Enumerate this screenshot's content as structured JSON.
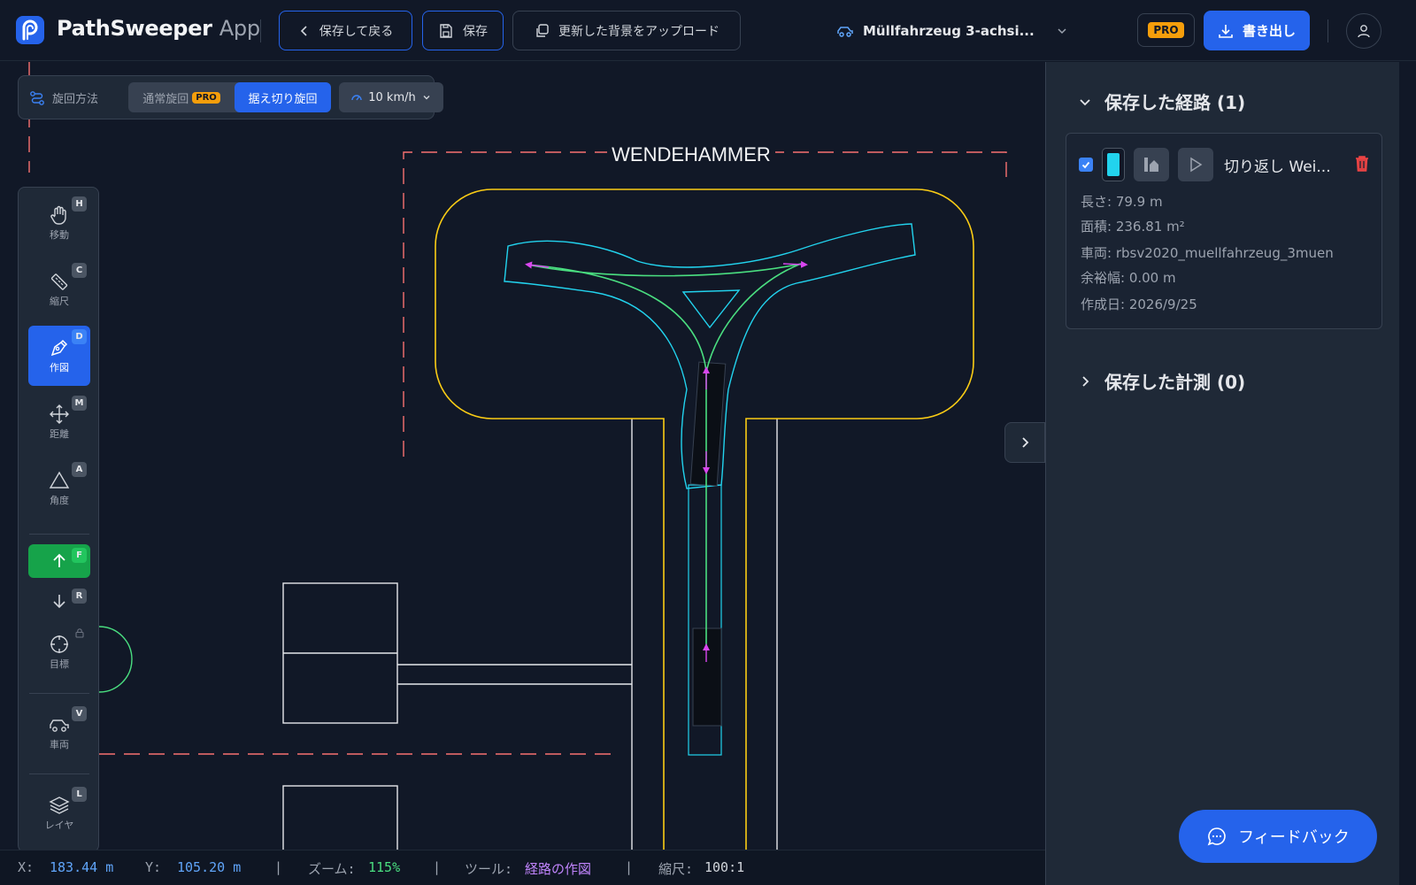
{
  "header": {
    "brand_name": "PathSweeper",
    "brand_suffix": "App",
    "back_label": "保存して戻る",
    "save_label": "保存",
    "upload_label": "更新した背景をアップロード",
    "vehicle_selected": "Müllfahrzeug 3-achsi...",
    "pro_label": "PRO",
    "export_label": "書き出し"
  },
  "turn_controls": {
    "label": "旋回方法",
    "normal_turn": "通常旋回",
    "normal_turn_badge": "PRO",
    "pivot_turn": "据え切り旋回",
    "speed": "10 km/h"
  },
  "canvas": {
    "area_label": "WENDEHAMMER",
    "colors": {
      "boundary": "#facc15",
      "envelope": "#22d3ee",
      "path": "#4ade80",
      "arrows": "#d946ef",
      "dashed": "#f87171",
      "lines": "#e5e7eb"
    }
  },
  "tools": [
    {
      "label": "移動",
      "key": "H",
      "icon": "hand-icon"
    },
    {
      "label": "縮尺",
      "key": "C",
      "icon": "ruler-icon"
    },
    {
      "label": "作図",
      "key": "D",
      "icon": "pen-icon"
    },
    {
      "label": "距離",
      "key": "M",
      "icon": "move-icon"
    },
    {
      "label": "角度",
      "key": "A",
      "icon": "triangle-icon"
    },
    {
      "label": "",
      "key": "F",
      "icon": "arrow-up-icon"
    },
    {
      "label": "",
      "key": "R",
      "icon": "arrow-down-icon"
    },
    {
      "label": "目標",
      "key": "",
      "icon": "crosshair-icon"
    },
    {
      "label": "車両",
      "key": "V",
      "icon": "car-icon"
    },
    {
      "label": "レイヤ",
      "key": "L",
      "icon": "layers-icon"
    }
  ],
  "panel": {
    "saved_routes_title": "保存した経路 (1)",
    "saved_measures_title": "保存した計測 (0)",
    "route": {
      "name": "切り返し Wei...",
      "color": "#22d3ee",
      "length": "長さ: 79.9 m",
      "area": "面積: 236.81 m²",
      "vehicle": "車両: rbsv2020_muellfahrzeug_3muen",
      "margin": "余裕幅: 0.00 m",
      "created": "作成日: 2026/9/25"
    }
  },
  "feedback_label": "フィードバック",
  "status": {
    "x_label": "X:",
    "x_value": "183.44 m",
    "y_label": "Y:",
    "y_value": "105.20 m",
    "zoom_label": "ズーム:",
    "zoom_value": "115%",
    "tool_label": "ツール:",
    "tool_value": "経路の作図",
    "scale_label": "縮尺:",
    "scale_value": "100:1",
    "separator": "|"
  }
}
